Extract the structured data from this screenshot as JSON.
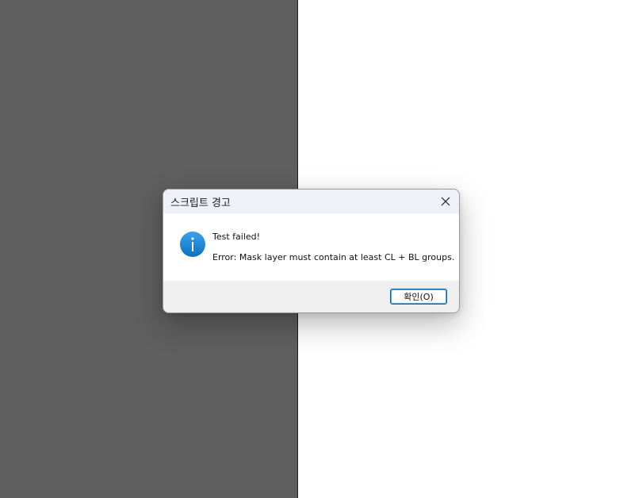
{
  "dialog": {
    "title": "스크립트 경고",
    "message_heading": "Test failed!",
    "message_body": "Error: Mask layer must contain at least CL + BL groups.",
    "ok_button_label": "확인(O)",
    "icon": "info-icon",
    "close_icon": "close-icon"
  },
  "colors": {
    "left_panel": "#5f5f5f",
    "right_panel": "#ffffff",
    "titlebar": "#eef1f8",
    "footer": "#efefef",
    "icon_blue": "#1a86d8",
    "button_border": "#0a5f9e"
  }
}
